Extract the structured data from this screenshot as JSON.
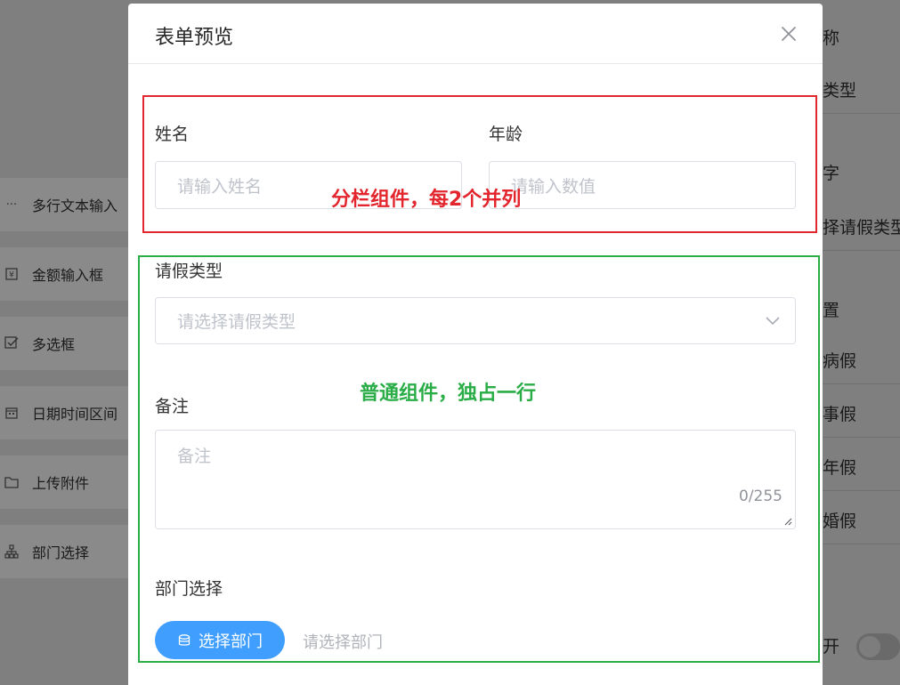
{
  "background": {
    "left_items": [
      {
        "label": "多行文本输入",
        "icon": "ellipsis-icon"
      },
      {
        "label": "金额输入框",
        "icon": "money-icon"
      },
      {
        "label": "多选框",
        "icon": "checkbox-icon"
      },
      {
        "label": "日期时间区间",
        "icon": "calendar-icon"
      },
      {
        "label": "上传附件",
        "icon": "folder-icon"
      },
      {
        "label": "部门选择",
        "icon": "org-tree-icon"
      }
    ],
    "right_items": [
      "称",
      "类型",
      "字",
      "择请假类型",
      "置",
      "病假",
      "事假",
      "年假",
      "婚假",
      "开"
    ]
  },
  "modal": {
    "title": "表单预览",
    "close_icon": "close-icon",
    "fields": {
      "name_label": "姓名",
      "name_placeholder": "请输入姓名",
      "age_label": "年龄",
      "age_placeholder": "请输入数值",
      "leave_type_label": "请假类型",
      "leave_type_placeholder": "请选择请假类型",
      "remark_label": "备注",
      "remark_placeholder": "备注",
      "remark_count": "0/255",
      "dept_label": "部门选择",
      "dept_button": "选择部门",
      "dept_placeholder": "请选择部门"
    },
    "annotations": {
      "red": "分栏组件，每2个并列",
      "green": "普通组件，独占一行"
    }
  },
  "colors": {
    "annotation_red": "#e3262e",
    "annotation_green": "#2aad47",
    "primary_button": "#409eff"
  }
}
